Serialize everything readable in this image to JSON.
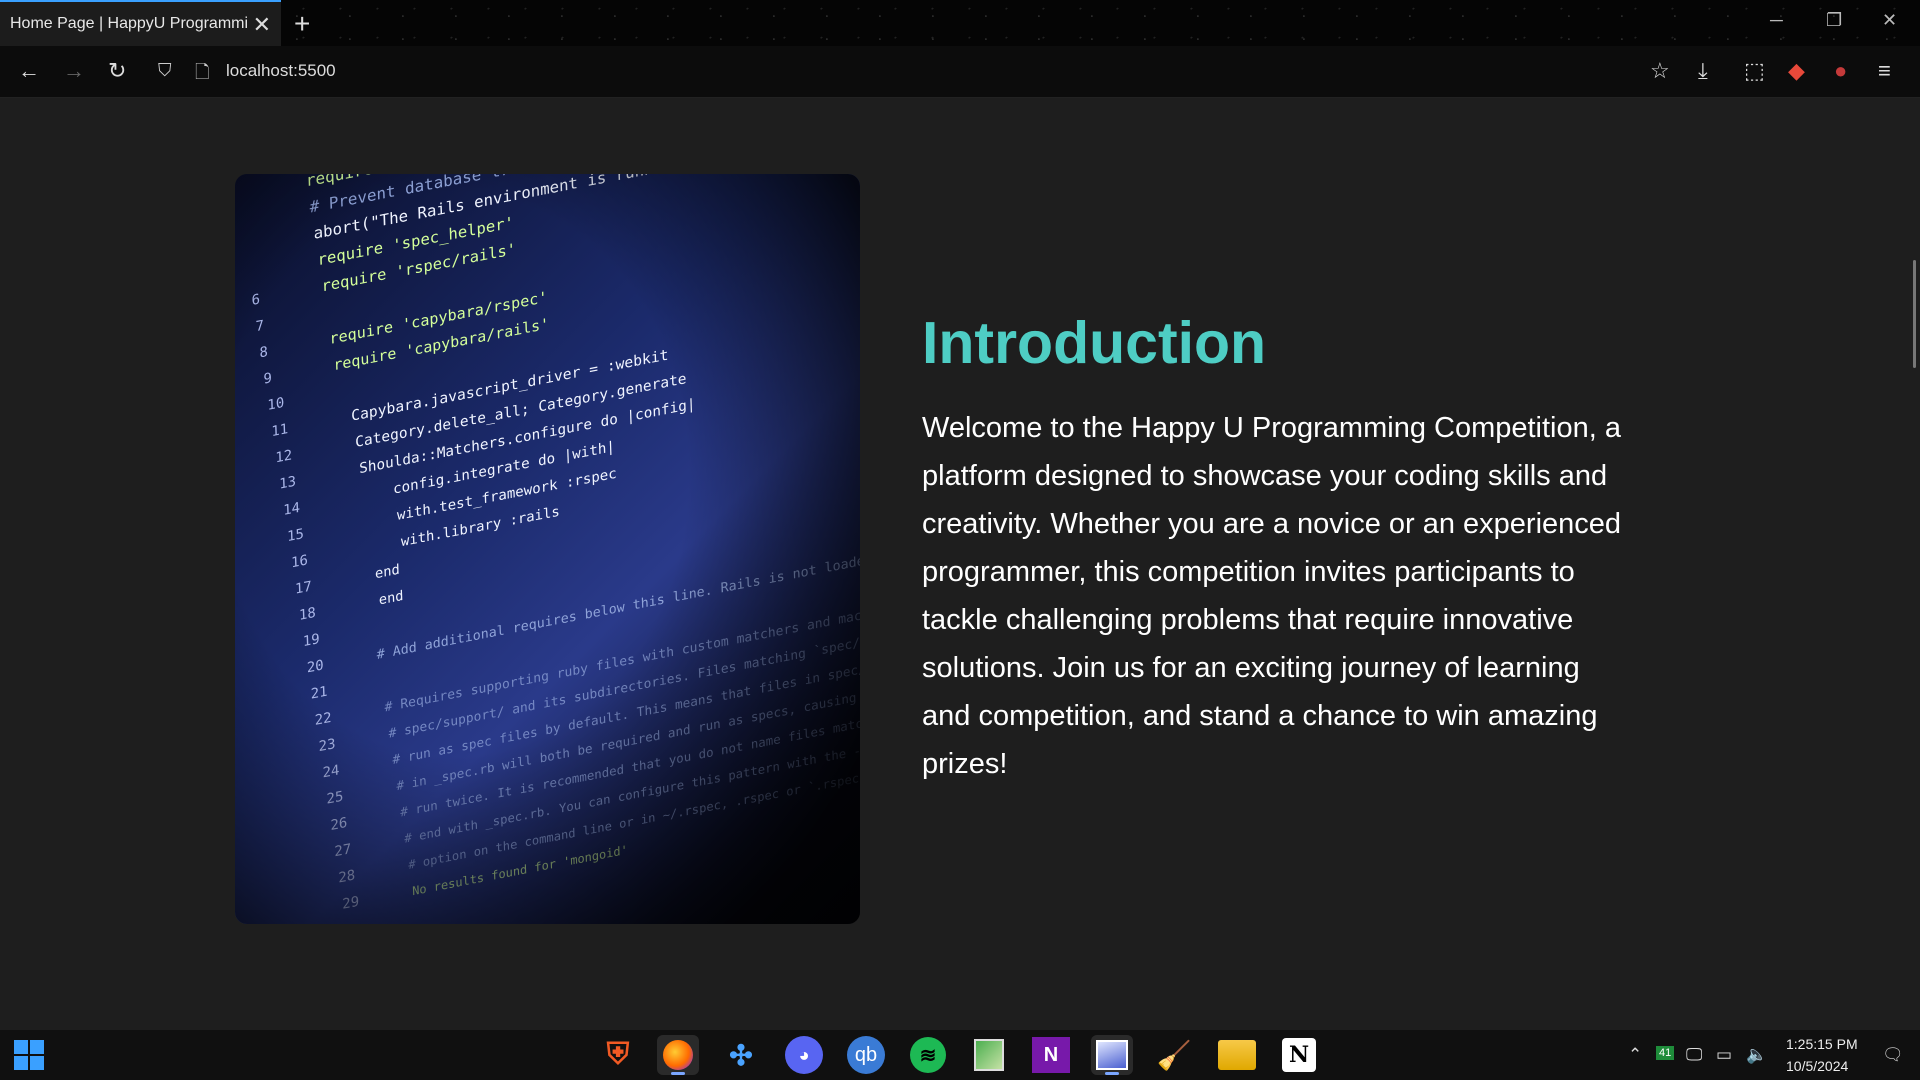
{
  "browser": {
    "tab_title": "Home Page | HappyU Programming",
    "url": "localhost:5500"
  },
  "page": {
    "section_title": "Introduction",
    "section_text": "Welcome to the Happy U Programming Competition, a platform designed to showcase your coding skills and creativity. Whether you are a novice or an experienced programmer, this competition invites participants to tackle challenging problems that require innovative solutions. Join us for an exciting journey of learning and competition, and stand a chance to win amazing prizes!",
    "image_code_lines": [
      "require File.expand_path('../../config/environment', __FILE__)",
      "# Prevent database truncation if the environment is production",
      "abort(\"The Rails environment is running in production mode!\")",
      "require 'spec_helper'",
      "require 'rspec/rails'",
      "",
      "require 'capybara/rspec'",
      "require 'capybara/rails'",
      "",
      "Capybara.javascript_driver = :webkit",
      "Category.delete_all; Category.generate",
      "Shoulda::Matchers.configure do |config|",
      "config.integrate do |with|",
      "with.test_framework :rspec",
      "with.library :rails",
      "end",
      "end",
      "",
      "# Add additional requires below this line. Rails is not loaded until this point!",
      "",
      "# Requires supporting ruby files with custom matchers and macros, etc,",
      "# spec/support/ and its subdirectories. Files matching `spec/**/*_spec.rb` are",
      "# run as spec files by default. This means that files in spec/support that end",
      "# in _spec.rb will both be required and run as specs, causing the specs to be",
      "# run twice. It is recommended that you do not name files matching this glob to",
      "# end with _spec.rb. You can configure this pattern with the --pattern",
      "# option on the command line or in ~/.rspec, .rspec or `.rspec-local`.",
      "No results found for 'mongoid'"
    ],
    "image_line_numbers": [
      "6",
      "7",
      "8",
      "9",
      "10",
      "11",
      "12",
      "13",
      "14",
      "15",
      "16",
      "17",
      "18",
      "19",
      "20",
      "21",
      "22",
      "23",
      "24",
      "25",
      "26",
      "27",
      "28",
      "29"
    ]
  },
  "taskbar": {
    "apps": [
      "brave-icon",
      "firefox-icon",
      "vscodium-icon",
      "discord-icon",
      "qbittorrent-icon",
      "spotify-icon",
      "notepad-icon",
      "onenote-icon",
      "snipping-tool-icon",
      "cleaner-icon",
      "file-explorer-icon",
      "notion-icon"
    ],
    "qb_label": "qb",
    "onenote_label": "N",
    "notion_label": "N",
    "badge": "41",
    "time": "1:25:15 PM",
    "date": "10/5/2024"
  }
}
